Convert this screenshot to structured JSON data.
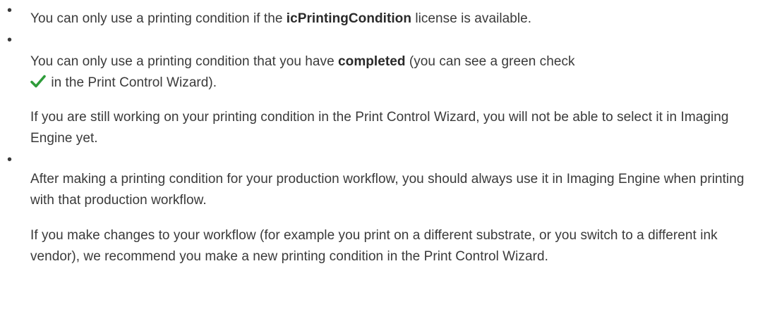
{
  "bullets": [
    {
      "text_before": "You can only use a printing condition if the ",
      "bold": "icPrintingCondition",
      "text_after": " license is available."
    },
    {
      "text_before": "You can only use a printing condition that you have ",
      "bold": "completed",
      "text_mid": " (you can see a green check",
      "icon": "green-checkmark-icon",
      "icon_color": "#2e9c3a",
      "text_after": " in the Print Control Wizard).",
      "note": "If you are still working on your printing condition in the Print Control Wizard, you will not be able to select it in Imaging Engine yet."
    },
    {
      "text": "After making a printing condition for your production workflow, you should always use it in Imaging Engine when printing with that production workflow.",
      "note": "If you make changes to your workflow (for example you print on a different substrate, or you switch to a different ink vendor), we recommend you make a new printing condition in the Print Control Wizard."
    }
  ],
  "bullet_glyph": "•"
}
